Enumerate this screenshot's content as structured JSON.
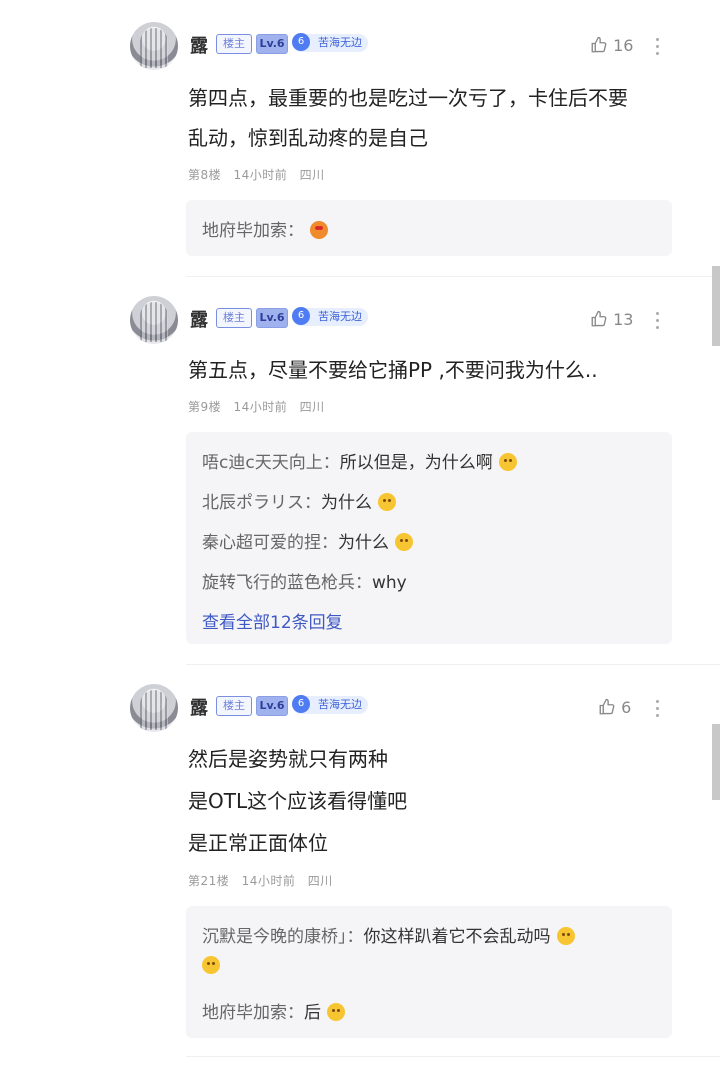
{
  "posts": [
    {
      "name": "露",
      "owner_tag": "楼主",
      "level": "Lv.6",
      "medal_num": "6",
      "medal": "苦海无边",
      "likes": "16",
      "lines": [
        "第四点，最重要的也是吃过一次亏了，卡住后不要",
        "乱动，惊到乱动疼的是自己"
      ],
      "floor": "第8楼",
      "time": "14小时前",
      "location": "四川",
      "replies": [
        {
          "who": "地府毕加索：",
          "text": "",
          "emoji": "heart-eyes-emoji"
        }
      ]
    },
    {
      "name": "露",
      "owner_tag": "楼主",
      "level": "Lv.6",
      "medal_num": "6",
      "medal": "苦海无边",
      "likes": "13",
      "lines": [
        "第五点，尽量不要给它捅PP ,不要问我为什么.."
      ],
      "floor": "第9楼",
      "time": "14小时前",
      "location": "四川",
      "replies": [
        {
          "who": "唔c迪c天天向上：",
          "text": "所以但是，为什么啊",
          "emoji": "sad-emoji"
        },
        {
          "who": "北辰ポラリス：",
          "text": "为什么",
          "emoji": "awkward-emoji"
        },
        {
          "who": "秦心超可爱的捏：",
          "text": "为什么",
          "emoji": "smile-emoji"
        },
        {
          "who": "旋转飞行的蓝色枪兵：",
          "text": "why",
          "emoji": ""
        }
      ],
      "more_replies": "查看全部12条回复"
    },
    {
      "name": "露",
      "owner_tag": "楼主",
      "level": "Lv.6",
      "medal_num": "6",
      "medal": "苦海无边",
      "likes": "6",
      "lines": [
        "然后是姿势就只有两种",
        "是OTL这个应该看得懂吧",
        "是正常正面体位"
      ],
      "floor": "第21楼",
      "time": "14小时前",
      "location": "四川",
      "replies": [
        {
          "who": "沉默是今晚的康桥」：",
          "text": "你这样趴着它不会乱动吗",
          "emoji": "grimace-emoji"
        },
        {
          "who": "地府毕加索：",
          "text": "后",
          "emoji": "laugh-tears-emoji"
        }
      ]
    }
  ]
}
